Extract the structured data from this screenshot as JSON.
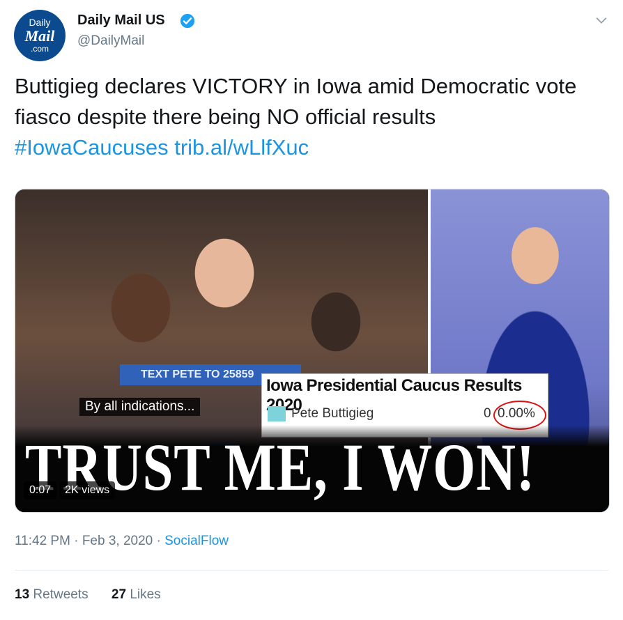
{
  "account": {
    "avatar_line1": "Daily",
    "avatar_line2": "Mail",
    "avatar_line3": ".com",
    "name": "Daily Mail US",
    "handle": "@DailyMail",
    "verified": true
  },
  "tweet": {
    "text": "Buttigieg declares VICTORY in Iowa amid Democratic vote fiasco despite there being NO official results",
    "hashtag": "#IowaCaucuses",
    "link": "trib.al/wLlfXuc"
  },
  "media": {
    "podium_sign": "TEXT PETE TO 25859",
    "results_title": "Iowa Presidential Caucus Results 2020",
    "candidate": "Pete Buttigieg",
    "votes": "0",
    "percent": "0.00%",
    "caption": "By all indications...",
    "headline": "TRUST ME, I WON!",
    "duration": "0:07",
    "views": "2K views"
  },
  "meta": {
    "time": "11:42 PM",
    "date": "Feb 3, 2020",
    "source": "SocialFlow"
  },
  "stats": {
    "retweets_count": "13",
    "retweets_label": "Retweets",
    "likes_count": "27",
    "likes_label": "Likes"
  },
  "icons": {
    "verified": "verified-badge-icon",
    "more": "chevron-down-icon"
  },
  "colors": {
    "link": "#1b95e0",
    "secondary_text": "#657786",
    "avatar_bg": "#0c4a8f"
  }
}
